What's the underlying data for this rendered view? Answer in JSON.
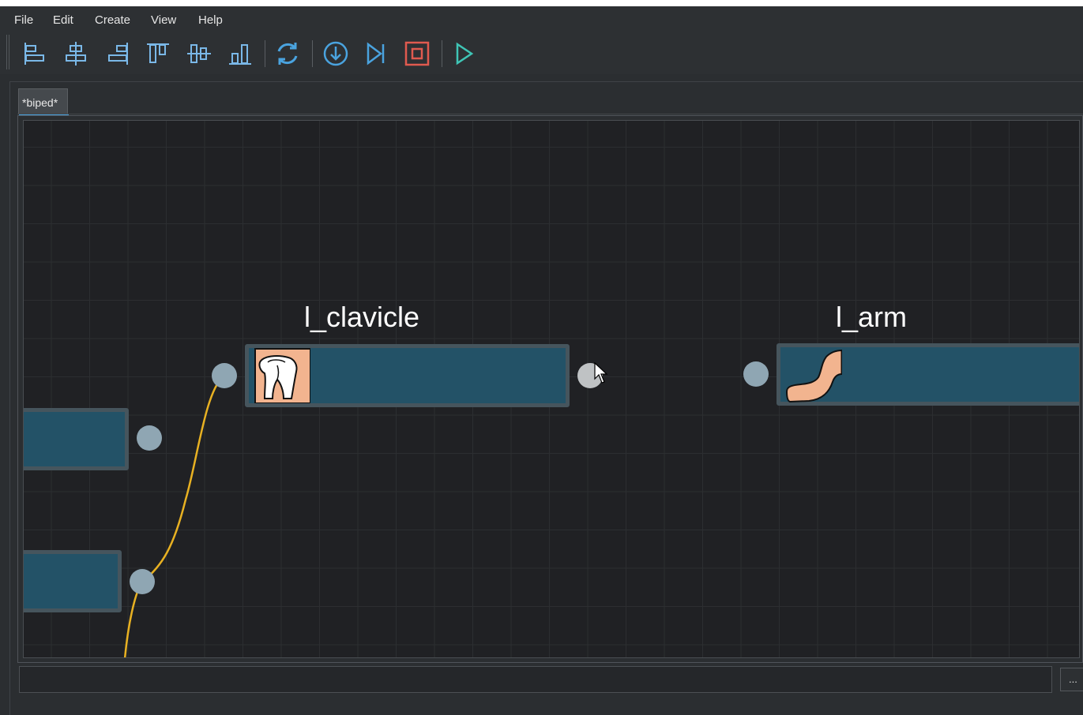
{
  "menubar": {
    "items": [
      {
        "label": "File"
      },
      {
        "label": "Edit"
      },
      {
        "label": "Create"
      },
      {
        "label": "View"
      },
      {
        "label": "Help"
      }
    ]
  },
  "toolbar": {
    "buttons": [
      {
        "icon": "align-left-icon"
      },
      {
        "icon": "align-center-horizontal-icon"
      },
      {
        "icon": "align-right-icon"
      },
      {
        "icon": "align-top-icon"
      },
      {
        "icon": "align-middle-vertical-icon"
      },
      {
        "icon": "align-bottom-icon"
      },
      {
        "icon": "refresh-icon"
      },
      {
        "icon": "step-down-icon"
      },
      {
        "icon": "skip-next-icon"
      },
      {
        "icon": "stop-icon"
      },
      {
        "icon": "play-icon"
      }
    ],
    "colors": {
      "align": "#7ab8e8",
      "refresh": "#4aa3df",
      "stop": "#e05a4f",
      "play": "#3fc5b6"
    }
  },
  "tabs": [
    {
      "label": "*biped*",
      "active": true
    }
  ],
  "graph": {
    "nodes": [
      {
        "title": "l_clavicle",
        "icon": "shoulder-icon"
      },
      {
        "title": "l_arm",
        "icon": "arm-icon"
      }
    ],
    "wire_color": "#e8b122",
    "node_color": "#235267",
    "port_color": "#8fa6b3"
  },
  "statusbar": {
    "value": "",
    "browse_label": "..."
  }
}
